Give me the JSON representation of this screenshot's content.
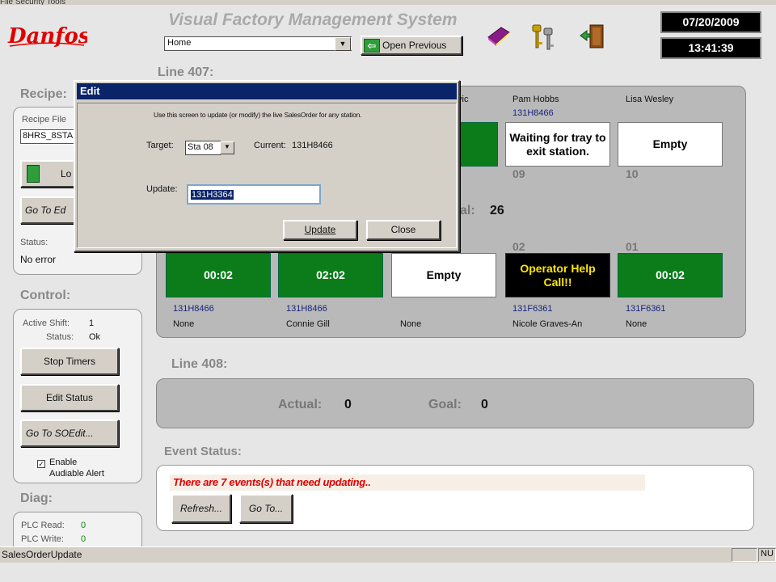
{
  "menubar": {
    "text": "File    Security    Tools"
  },
  "header": {
    "brand": "Danfoss",
    "app_title": "Visual Factory Management System",
    "view_select": "Home",
    "open_previous_label": "Open Previous",
    "date": "07/20/2009",
    "time": "13:41:39",
    "icons": [
      "book-icon",
      "keys-icon",
      "exit-door-icon"
    ]
  },
  "sidebar": {
    "recipe_title": "Recipe:",
    "recipe_file_label": "Recipe File",
    "recipe_file_value": "8HRS_8STA",
    "load_label": "Lo",
    "go_to_edit_label": "Go To Ed",
    "status_label": "Status:",
    "status_value": "No error",
    "control_title": "Control:",
    "active_shift_label": "Active Shift:",
    "active_shift_value": "1",
    "control_status_label": "Status:",
    "control_status_value": "Ok",
    "stop_timers_label": "Stop Timers",
    "edit_status_label": "Edit Status",
    "go_to_soedit_label": "Go To SOEdit...",
    "enable_alert_label_1": "Enable",
    "enable_alert_label_2": "Audiable Alert",
    "enable_alert_checked": true,
    "diag_title": "Diag:",
    "plc_read_label": "PLC Read:",
    "plc_read_value": "0",
    "plc_write_label": "PLC Write:",
    "plc_write_value": "0"
  },
  "line407": {
    "title": "Line 407:",
    "goal_label": "al:",
    "goal_value": "26",
    "top_row": {
      "partial_name": "vic",
      "stations": [
        {
          "number": "09",
          "person": "Pam Hobbs",
          "so": "131H8466",
          "text": "Waiting for tray to exit station.",
          "style": "white"
        },
        {
          "number": "10",
          "person": "Lisa Wesley",
          "so": "",
          "text": "Empty",
          "style": "white"
        }
      ]
    },
    "bottom_row": [
      {
        "number": "",
        "text": "00:02",
        "style": "green",
        "so": "131H8466",
        "person": "None"
      },
      {
        "number": "",
        "text": "02:02",
        "style": "green",
        "so": "131H8466",
        "person": "Connie Gill"
      },
      {
        "number": "",
        "text": "Empty",
        "style": "white",
        "so": "",
        "person": "None"
      },
      {
        "number": "02",
        "text": "Operator Help Call!!",
        "style": "black",
        "so": "131F6361",
        "person": "Nicole Graves-An"
      },
      {
        "number": "01",
        "text": "00:02",
        "style": "green",
        "so": "131F6361",
        "person": "None"
      }
    ]
  },
  "line408": {
    "title": "Line 408:",
    "actual_label": "Actual:",
    "actual_value": "0",
    "goal_label": "Goal:",
    "goal_value": "0"
  },
  "events": {
    "title": "Event Status:",
    "message": "There are 7 events(s) that need updating..",
    "refresh_label": "Refresh...",
    "goto_label": "Go To..."
  },
  "statusbar": {
    "text": "SalesOrderUpdate",
    "num": "NU"
  },
  "dialog": {
    "title": "Edit",
    "instructions": "Use this screen to update (or modify) the live SalesOrder for any station.",
    "target_label": "Target:",
    "target_value": "Sta 08",
    "current_label": "Current:",
    "current_value": "131H8466",
    "update_label": "Update:",
    "update_value": "131H3364",
    "update_button": "Update",
    "close_button": "Close"
  },
  "colors": {
    "station_green": "#0c7c1a",
    "title_bar": "#0a246a",
    "alert_yellow": "#ffe600",
    "event_red": "#e00000",
    "so_blue": "#1a237e"
  }
}
